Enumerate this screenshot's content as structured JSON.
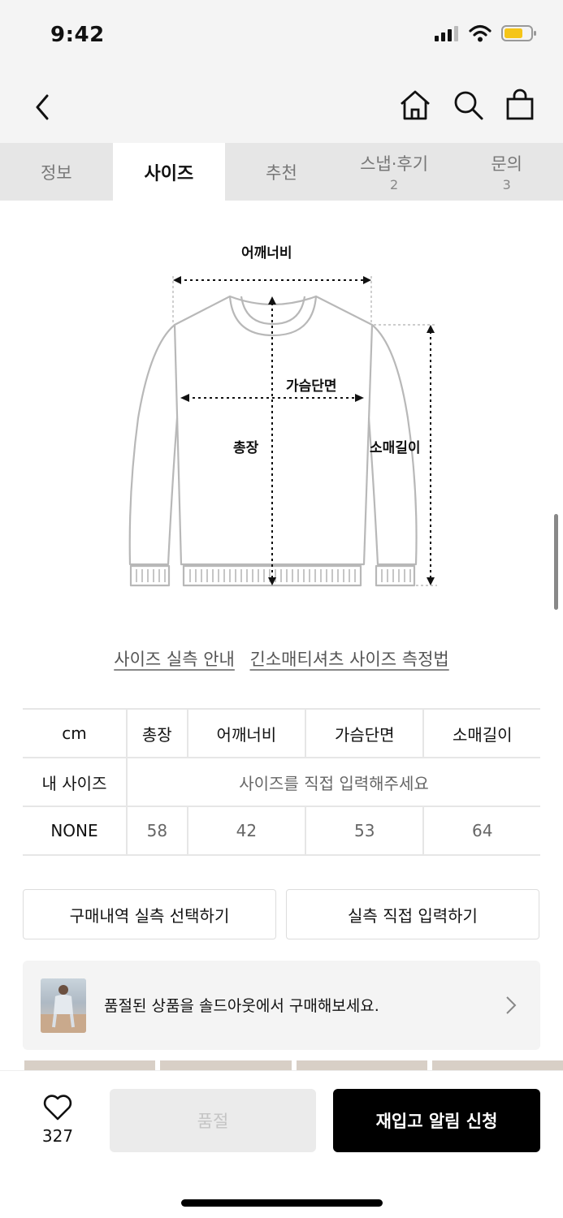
{
  "status": {
    "time": "9:42"
  },
  "tabs": [
    {
      "label": "정보",
      "count": ""
    },
    {
      "label": "사이즈",
      "count": ""
    },
    {
      "label": "추천",
      "count": ""
    },
    {
      "label": "스냅·후기",
      "count": "2"
    },
    {
      "label": "문의",
      "count": "3"
    }
  ],
  "diagram": {
    "shoulder": "어깨너비",
    "chest": "가슴단면",
    "length": "총장",
    "sleeve": "소매길이"
  },
  "links": {
    "guide": "사이즈 실측 안내",
    "method": "긴소매티셔츠 사이즈 측정법"
  },
  "table": {
    "unit": "cm",
    "headers": [
      "총장",
      "어깨너비",
      "가슴단면",
      "소매길이"
    ],
    "my_size_label": "내 사이즈",
    "my_size_prompt": "사이즈를 직접 입력해주세요",
    "row_label": "NONE",
    "row_values": [
      "58",
      "42",
      "53",
      "64"
    ]
  },
  "actions": {
    "select_purchase": "구매내역 실측 선택하기",
    "direct_input": "실측 직접 입력하기"
  },
  "banner": {
    "text": "품절된 상품을 솔드아웃에서 구매해보세요."
  },
  "bottom": {
    "like_count": "327",
    "soldout": "품절",
    "restock": "재입고 알림 신청"
  }
}
